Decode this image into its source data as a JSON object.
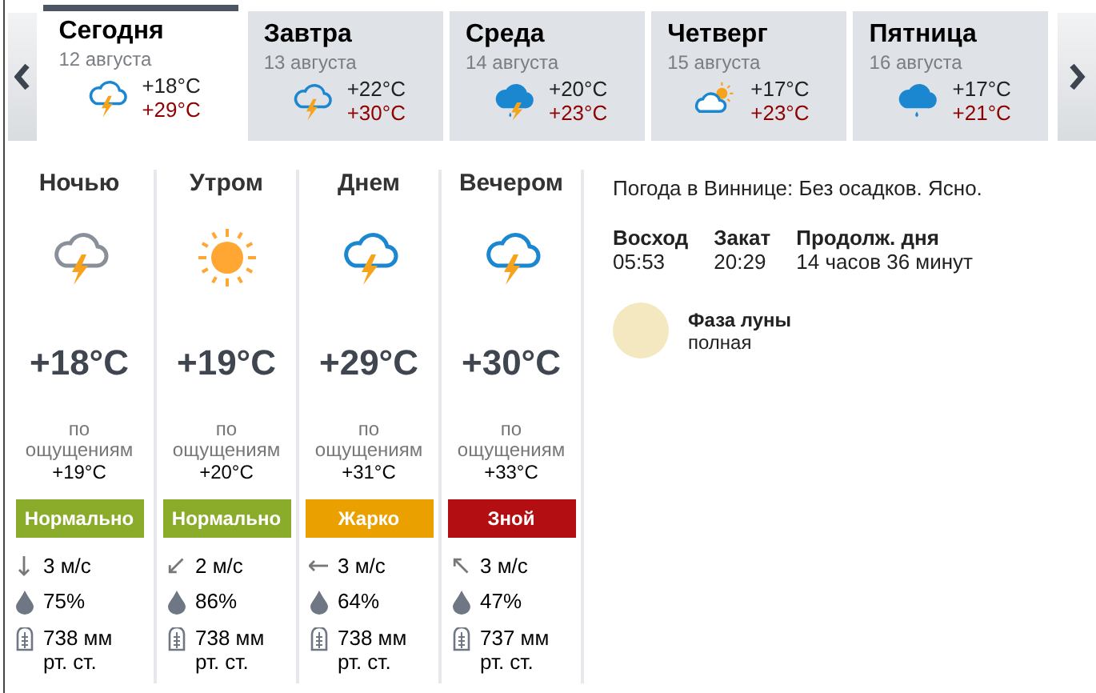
{
  "days": [
    {
      "name": "Сегодня",
      "date": "12 августа",
      "min": "+18°C",
      "max": "+29°C",
      "kind": "storm",
      "selected": true
    },
    {
      "name": "Завтра",
      "date": "13 августа",
      "min": "+22°C",
      "max": "+30°C",
      "kind": "storm",
      "selected": false
    },
    {
      "name": "Среда",
      "date": "14 августа",
      "min": "+20°C",
      "max": "+23°C",
      "kind": "rain-storm",
      "selected": false
    },
    {
      "name": "Четверг",
      "date": "15 августа",
      "min": "+17°C",
      "max": "+23°C",
      "kind": "partly-sunny",
      "selected": false
    },
    {
      "name": "Пятница",
      "date": "16 августа",
      "min": "+17°C",
      "max": "+21°C",
      "kind": "rain",
      "selected": false
    }
  ],
  "periods": [
    {
      "name": "Ночью",
      "kind": "storm-night",
      "temp": "+18°C",
      "feels_label": "по ощущениям",
      "feels": "+19°C",
      "comfort": "Нормально",
      "color": "#8bab2a",
      "wind": {
        "kind": "s",
        "speed": "3 м/с"
      },
      "humidity": "75%",
      "pressure": "738 мм рт. ст."
    },
    {
      "name": "Утром",
      "kind": "sun",
      "temp": "+19°C",
      "feels_label": "по ощущениям",
      "feels": "+20°C",
      "comfort": "Нормально",
      "color": "#8bab2a",
      "wind": {
        "kind": "sw",
        "speed": "2 м/с"
      },
      "humidity": "86%",
      "pressure": "738 мм рт. ст."
    },
    {
      "name": "Днем",
      "kind": "storm",
      "temp": "+29°C",
      "feels_label": "по ощущениям",
      "feels": "+31°C",
      "comfort": "Жарко",
      "color": "#eaa100",
      "wind": {
        "kind": "w",
        "speed": "3 м/с"
      },
      "humidity": "64%",
      "pressure": "738 мм рт. ст."
    },
    {
      "name": "Вечером",
      "kind": "storm",
      "temp": "+30°C",
      "feels_label": "по ощущениям",
      "feels": "+33°C",
      "comfort": "Зной",
      "color": "#b30f12",
      "wind": {
        "kind": "nw",
        "speed": "3 м/с"
      },
      "humidity": "47%",
      "pressure": "737 мм рт. ст."
    }
  ],
  "summary": "Погода в Виннице: Без осадков. Ясно.",
  "sun": [
    {
      "label": "Восход",
      "value": "05:53"
    },
    {
      "label": "Закат",
      "value": "20:29"
    },
    {
      "label": "Продолж. дня",
      "value": "14 часов 36 минут"
    }
  ],
  "moon": {
    "label": "Фаза луны",
    "value": "полная"
  }
}
